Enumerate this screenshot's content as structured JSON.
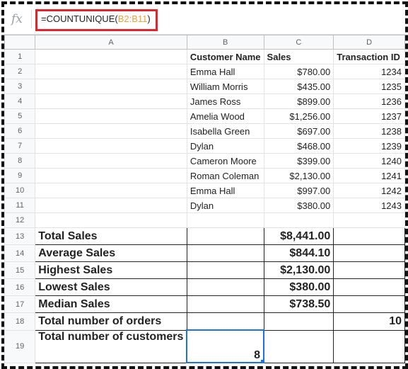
{
  "formula_bar": {
    "fx_label": "fx",
    "formula_prefix": "=COUNTUNIQUE(",
    "formula_range": "B2:B11",
    "formula_suffix": ")"
  },
  "column_headers": [
    "A",
    "B",
    "C",
    "D"
  ],
  "header_row": {
    "row_num": "1",
    "b": "Customer Name",
    "c": "Sales",
    "d": "Transaction ID"
  },
  "rows": [
    {
      "row_num": "2",
      "name": "Emma Hall",
      "sales": "$780.00",
      "id": "1234"
    },
    {
      "row_num": "3",
      "name": "William Morris",
      "sales": "$435.00",
      "id": "1235"
    },
    {
      "row_num": "4",
      "name": "James Ross",
      "sales": "$899.00",
      "id": "1236"
    },
    {
      "row_num": "5",
      "name": "Amelia Wood",
      "sales": "$1,256.00",
      "id": "1237"
    },
    {
      "row_num": "6",
      "name": "Isabella Green",
      "sales": "$697.00",
      "id": "1238"
    },
    {
      "row_num": "7",
      "name": "Dylan",
      "sales": "$468.00",
      "id": "1239"
    },
    {
      "row_num": "8",
      "name": "Cameron Moore",
      "sales": "$399.00",
      "id": "1240"
    },
    {
      "row_num": "9",
      "name": "Roman Coleman",
      "sales": "$2,130.00",
      "id": "1241"
    },
    {
      "row_num": "10",
      "name": "Emma Hall",
      "sales": "$997.00",
      "id": "1242"
    },
    {
      "row_num": "11",
      "name": "Dylan",
      "sales": "$380.00",
      "id": "1243"
    }
  ],
  "empty_row": {
    "row_num": "12"
  },
  "summary": [
    {
      "row_num": "13",
      "label": "Total Sales",
      "value": "$8,441.00"
    },
    {
      "row_num": "14",
      "label": "Average Sales",
      "value": "$844.10"
    },
    {
      "row_num": "15",
      "label": "Highest Sales",
      "value": "$2,130.00"
    },
    {
      "row_num": "16",
      "label": "Lowest Sales",
      "value": "$380.00"
    },
    {
      "row_num": "17",
      "label": "Median Sales",
      "value": "$738.50"
    }
  ],
  "orders_row": {
    "row_num": "18",
    "label": "Total number of orders",
    "value": "10"
  },
  "customers_row": {
    "row_num": "19",
    "label": "Total number of customers",
    "value": "8"
  },
  "colors": {
    "formula_highlight_border": "#e0262a",
    "range_reference": "#e8a33b",
    "selection": "#1a73e8",
    "frame_border": "#111111"
  }
}
